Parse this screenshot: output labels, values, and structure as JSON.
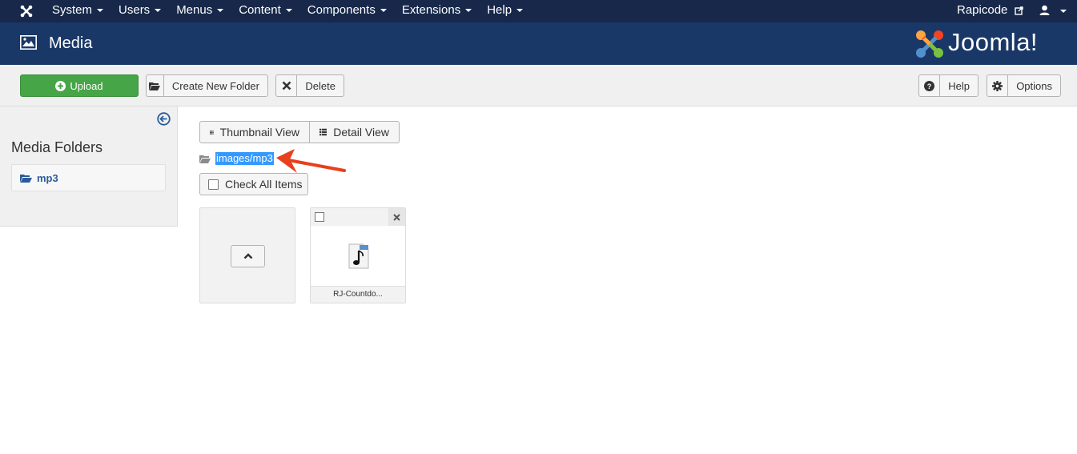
{
  "topnav": {
    "menu": [
      "System",
      "Users",
      "Menus",
      "Content",
      "Components",
      "Extensions",
      "Help"
    ],
    "user_name": "Rapicode"
  },
  "header": {
    "title": "Media",
    "brand": "Joomla!"
  },
  "toolbar": {
    "upload_label": "Upload",
    "new_folder_label": "Create New Folder",
    "delete_label": "Delete",
    "help_label": "Help",
    "options_label": "Options"
  },
  "sidebar": {
    "heading": "Media Folders",
    "folders": [
      "mp3"
    ]
  },
  "main": {
    "thumbnail_view_label": "Thumbnail View",
    "detail_view_label": "Detail View",
    "current_path": "images/mp3",
    "check_all_label": "Check All Items",
    "files": [
      {
        "name": "RJ-Countdo...",
        "type": "audio"
      }
    ]
  },
  "colors": {
    "topnav_bg": "#17284a",
    "header_bg": "#1a3867",
    "upload_green": "#46a546",
    "link_blue": "#2b5b99",
    "selection_blue": "#3399ff",
    "annotation_arrow": "#e8401c"
  }
}
